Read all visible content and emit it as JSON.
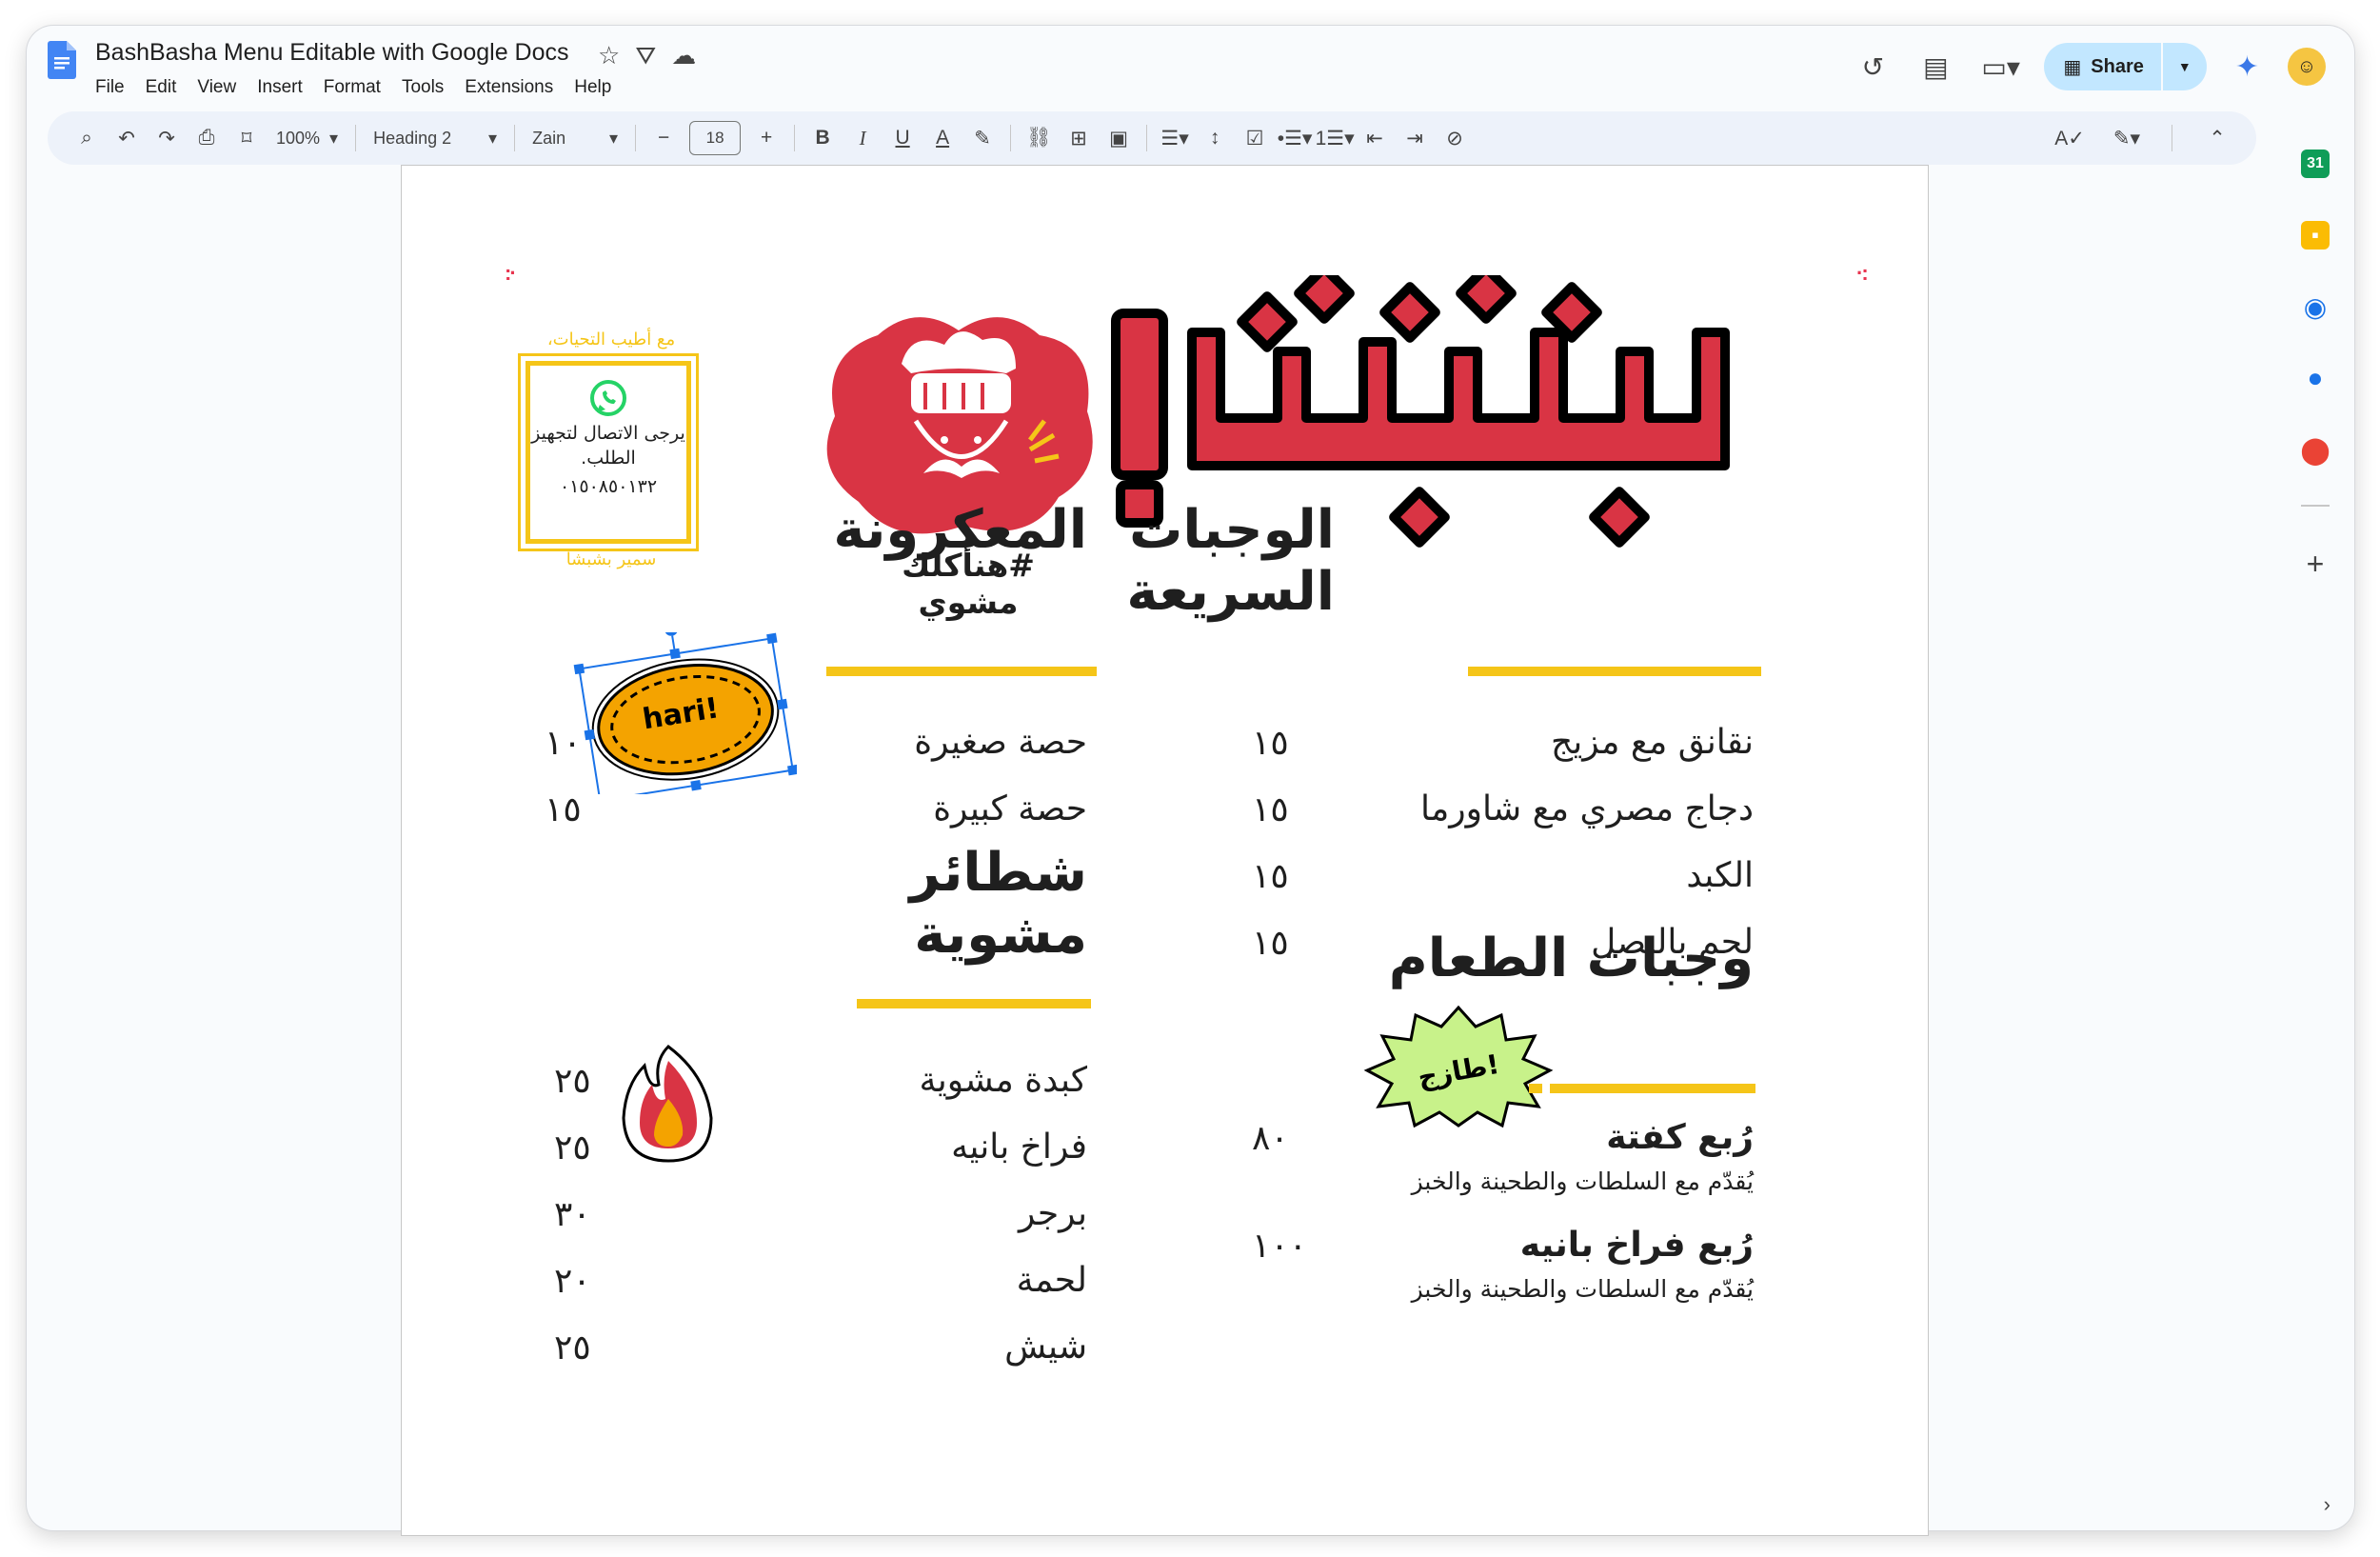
{
  "app": {
    "doc_title": "BashBasha Menu Editable with Google Docs",
    "menu": [
      "File",
      "Edit",
      "View",
      "Insert",
      "Format",
      "Tools",
      "Extensions",
      "Help"
    ],
    "share_label": "Share"
  },
  "toolbar": {
    "zoom": "100%",
    "style": "Heading 2",
    "font": "Zain",
    "font_size": "18",
    "bold": "B",
    "italic": "I",
    "underline": "U",
    "text_color": "A"
  },
  "document": {
    "contact": {
      "top_text": "مع أطيب التحيات،",
      "line1": "يرجى الاتصال لتجهيز الطلب.",
      "phone": "٠١٥٠٨٥٠١٣٢",
      "bottom_text": "سمير بشبشا"
    },
    "hashtag": "#هنأكلك مشوي",
    "sticker_hari": "hari!",
    "sticker_fresh": "طازج!",
    "fast_meals": {
      "title": "الوجبات السريعة",
      "items": [
        {
          "name": "نقانق مع مزيج",
          "price": "١٥"
        },
        {
          "name": "دجاج مصري مع شاورما",
          "price": "١٥"
        },
        {
          "name": "الكبد",
          "price": "١٥"
        },
        {
          "name": "لحم بالبصل",
          "price": "١٥"
        }
      ]
    },
    "macaroni": {
      "title": "المعكرونة",
      "items": [
        {
          "name": "حصة صغيرة",
          "price": "١٠"
        },
        {
          "name": "حصة كبيرة",
          "price": "١٥"
        }
      ]
    },
    "grilled_sandwiches": {
      "title": "شطائر مشوية",
      "items": [
        {
          "name": "كبدة مشوية",
          "price": "٢٥"
        },
        {
          "name": "فراخ بانيه",
          "price": "٢٥"
        },
        {
          "name": "برجر",
          "price": "٣٠"
        },
        {
          "name": "لحمة",
          "price": "٢٠"
        },
        {
          "name": "شيش",
          "price": "٢٥"
        }
      ]
    },
    "meals": {
      "title": "وجبات الطعام",
      "items": [
        {
          "name": "رُبع كفتة",
          "desc": "يُقدّم مع السلطات والطحينة والخبز",
          "price": "٨٠"
        },
        {
          "name": "رُبع فراخ بانيه",
          "desc": "يُقدّم مع السلطات والطحينة والخبز",
          "price": "١٠٠"
        }
      ]
    }
  },
  "colors": {
    "accent_yellow": "#f5c518",
    "brand_red": "#d93444",
    "share_bg": "#c2e7ff"
  }
}
